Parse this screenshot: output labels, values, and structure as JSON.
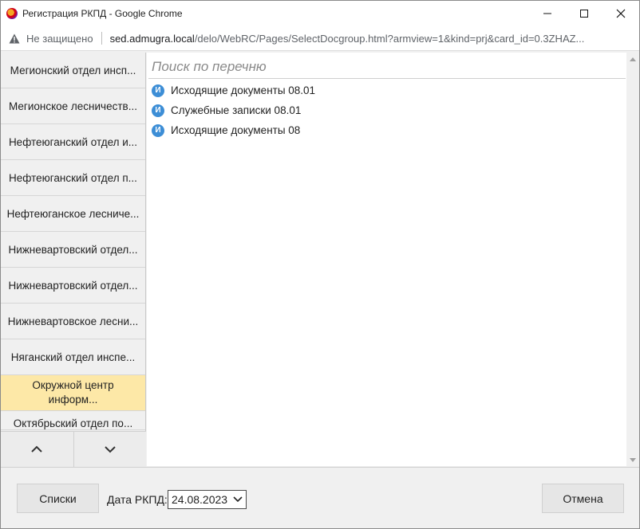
{
  "window": {
    "title": "Регистрация РКПД - Google Chrome",
    "minimize_glyph": "—",
    "maximize_glyph": "☐",
    "close_glyph": "✕"
  },
  "address": {
    "security_label": "Не защищено",
    "url_host": "sed.admugra.local",
    "url_path": "/delo/WebRC/Pages/SelectDocgroup.html?armview=1&kind=prj&card_id=0.3ZHAZ..."
  },
  "left_list": {
    "items": [
      {
        "label": "Мегионский отдел инсп..."
      },
      {
        "label": "Мегионское лесничеств..."
      },
      {
        "label": "Нефтеюганский отдел и..."
      },
      {
        "label": "Нефтеюганский отдел п..."
      },
      {
        "label": "Нефтеюганское лесниче..."
      },
      {
        "label": "Нижневартовский отдел..."
      },
      {
        "label": "Нижневартовский отдел..."
      },
      {
        "label": "Нижневартовское лесни..."
      },
      {
        "label": "Няганский отдел инспе..."
      }
    ],
    "active_item": {
      "label": "Окружной центр информ..."
    },
    "partial_item": {
      "label": "Октябрьский отдел по..."
    }
  },
  "content": {
    "search_placeholder": "Поиск по перечню",
    "documents": [
      {
        "icon_letter": "И",
        "label": "Исходящие документы 08.01"
      },
      {
        "icon_letter": "И",
        "label": "Служебные записки 08.01"
      },
      {
        "icon_letter": "И",
        "label": "Исходящие документы 08"
      }
    ]
  },
  "footer": {
    "lists_button": "Списки",
    "date_label": "Дата РКПД:",
    "date_value": "24.08.2023",
    "cancel_button": "Отмена"
  },
  "colors": {
    "active_item_bg": "#fde8a7",
    "doc_icon_bg": "#3d8ed6"
  }
}
